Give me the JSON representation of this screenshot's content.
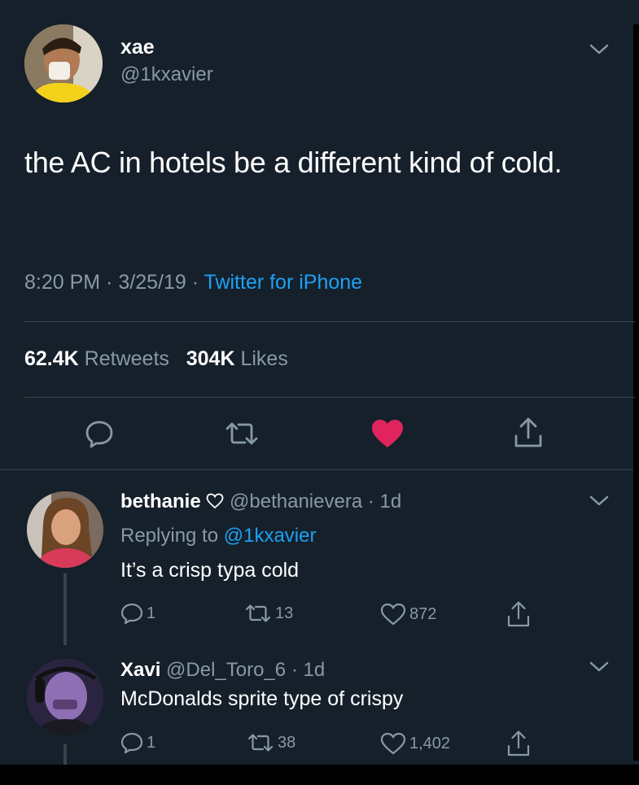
{
  "tweet": {
    "display_name": "xae",
    "handle": "@1kxavier",
    "text": "the AC in hotels be a different kind of cold.",
    "time": "8:20 PM",
    "date": "3/25/19",
    "source": "Twitter for iPhone",
    "retweets_count": "62.4K",
    "retweets_label": "Retweets",
    "likes_count": "304K",
    "likes_label": "Likes",
    "liked": true,
    "like_color": "#e0245e",
    "link_color": "#1da1f2"
  },
  "replies": [
    {
      "display_name": "bethanie",
      "handle": "@bethanievera",
      "age": "1d",
      "replying_prefix": "Replying to",
      "replying_to": "@1kxavier",
      "text": "It’s a crisp typa cold",
      "reply_count": "1",
      "retweet_count": "13",
      "like_count": "872"
    },
    {
      "display_name": "Xavi",
      "handle": "@Del_Toro_6",
      "age": "1d",
      "text": "McDonalds sprite type of crispy",
      "reply_count": "1",
      "retweet_count": "38",
      "like_count": "1,402"
    }
  ],
  "icons": [
    "chevron-down-icon",
    "reply-icon",
    "retweet-icon",
    "heart-icon",
    "share-icon",
    "heart-outline-icon"
  ]
}
